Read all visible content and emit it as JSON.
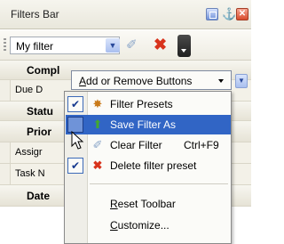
{
  "panel": {
    "title": "Filters Bar",
    "title_buttons": [
      "restore-icon",
      "pin-icon",
      "close-icon"
    ]
  },
  "toolbar": {
    "filter_value": "My filter",
    "icons": [
      "dropdown-arrow-icon",
      "eraser-icon",
      "delete-icon",
      "toolbar-overflow-icon"
    ]
  },
  "grid": {
    "rows": [
      {
        "label": "Compl",
        "style": "bold"
      },
      {
        "label": "Due D",
        "style": "plain"
      },
      {
        "label": "Statu",
        "style": "bold"
      },
      {
        "label": "Prior",
        "style": "bold"
      },
      {
        "label": "Assigr",
        "style": "plain"
      },
      {
        "label": "Task N",
        "style": "plain"
      },
      {
        "label": "Date",
        "style": "bold"
      }
    ]
  },
  "add_remove": {
    "label_underlined": "A",
    "label_rest": "dd or Remove Buttons"
  },
  "menu": {
    "items": [
      {
        "label": "Filter Presets",
        "checked": true,
        "icon": "filter-presets-icon",
        "highlighted": false
      },
      {
        "label": "Save Filter As",
        "checked": true,
        "icon": "save-filter-icon",
        "highlighted": true
      },
      {
        "label": "Clear Filter",
        "shortcut": "Ctrl+F9",
        "checked": false,
        "icon": "eraser-icon",
        "highlighted": false
      },
      {
        "label": "Delete filter preset",
        "checked": true,
        "icon": "delete-icon",
        "highlighted": false
      }
    ],
    "reset": {
      "underlined": "R",
      "rest": "eset Toolbar"
    },
    "customize": {
      "underlined": "C",
      "rest": "ustomize..."
    }
  },
  "colors": {
    "menu_highlight": "#3165c5",
    "delete_red": "#d8331c"
  }
}
